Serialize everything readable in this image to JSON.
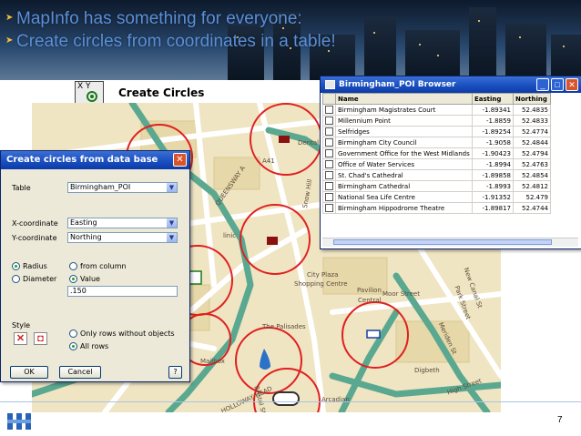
{
  "banner": {
    "line1": "MapInfo has something for everyone:",
    "line2": "Create circles from coordinates in a table!"
  },
  "caption": {
    "icon_text": "X Y",
    "label": "Create Circles"
  },
  "map_labels": {
    "a41": "A41",
    "dental": "Dental",
    "queensway": "QUEENSWAY A",
    "clinic": "linic",
    "city_plaza": "City Plaza",
    "shopping_centre": "Shopping Centre",
    "pavilion": "Pavilion",
    "central": "Central",
    "moor_street": "Moor Street",
    "the_palisades": "The Palisades",
    "mailbox": "Mailbox",
    "park_street": "Park Street",
    "digbeth": "Digbeth",
    "high_street": "High Street",
    "arcadian": "Arcadian",
    "holloway_head": "HOLLOWAY HEAD",
    "bristol_st": "Bristol St",
    "meriden_st": "Meriden St",
    "new_canal_st": "New Canal St",
    "snow_hill": "Snow Hill"
  },
  "dialog": {
    "title": "Create circles from data base",
    "table_label": "Table",
    "table_value": "Birmingham_POI",
    "x_label": "X-coordinate",
    "x_value": "Easting",
    "y_label": "Y-coordinate",
    "y_value": "Northing",
    "radius_label": "Radius",
    "diameter_label": "Diameter",
    "from_column_label": "from column",
    "value_label": "Value",
    "value_input": ".150",
    "style_label": "Style",
    "only_rows_label": "Only rows without objects",
    "all_rows_label": "All rows",
    "ok_label": "OK",
    "cancel_label": "Cancel",
    "help_label": "?",
    "close_label": "✕"
  },
  "browser": {
    "title": "Birmingham_POI Browser",
    "minimize": "_",
    "maximize": "□",
    "close": "✕",
    "columns": [
      "Name",
      "Easting",
      "Northing"
    ],
    "rows": [
      [
        "Birmingham Magistrates Court",
        "-1.89341",
        "52.4835"
      ],
      [
        "Millennium Point",
        "-1.8859",
        "52.4833"
      ],
      [
        "Selfridges",
        "-1.89254",
        "52.4774"
      ],
      [
        "Birmingham City Council",
        "-1.9058",
        "52.4844"
      ],
      [
        "Government Office for the West Midlands",
        "-1.90423",
        "52.4794"
      ],
      [
        "Office of Water Services",
        "-1.8994",
        "52.4763"
      ],
      [
        "St. Chad's Cathedral",
        "-1.89858",
        "52.4854"
      ],
      [
        "Birmingham Cathedral",
        "-1.8993",
        "52.4812"
      ],
      [
        "National Sea Life Centre",
        "-1.91352",
        "52.479"
      ],
      [
        "Birmingham Hippodrome Theatre",
        "-1.89817",
        "52.4744"
      ]
    ]
  },
  "footer": {
    "page_number": "7"
  },
  "colors": {
    "accent": "#1d52c2",
    "circle": "#e02020",
    "road": "#5aa890"
  }
}
